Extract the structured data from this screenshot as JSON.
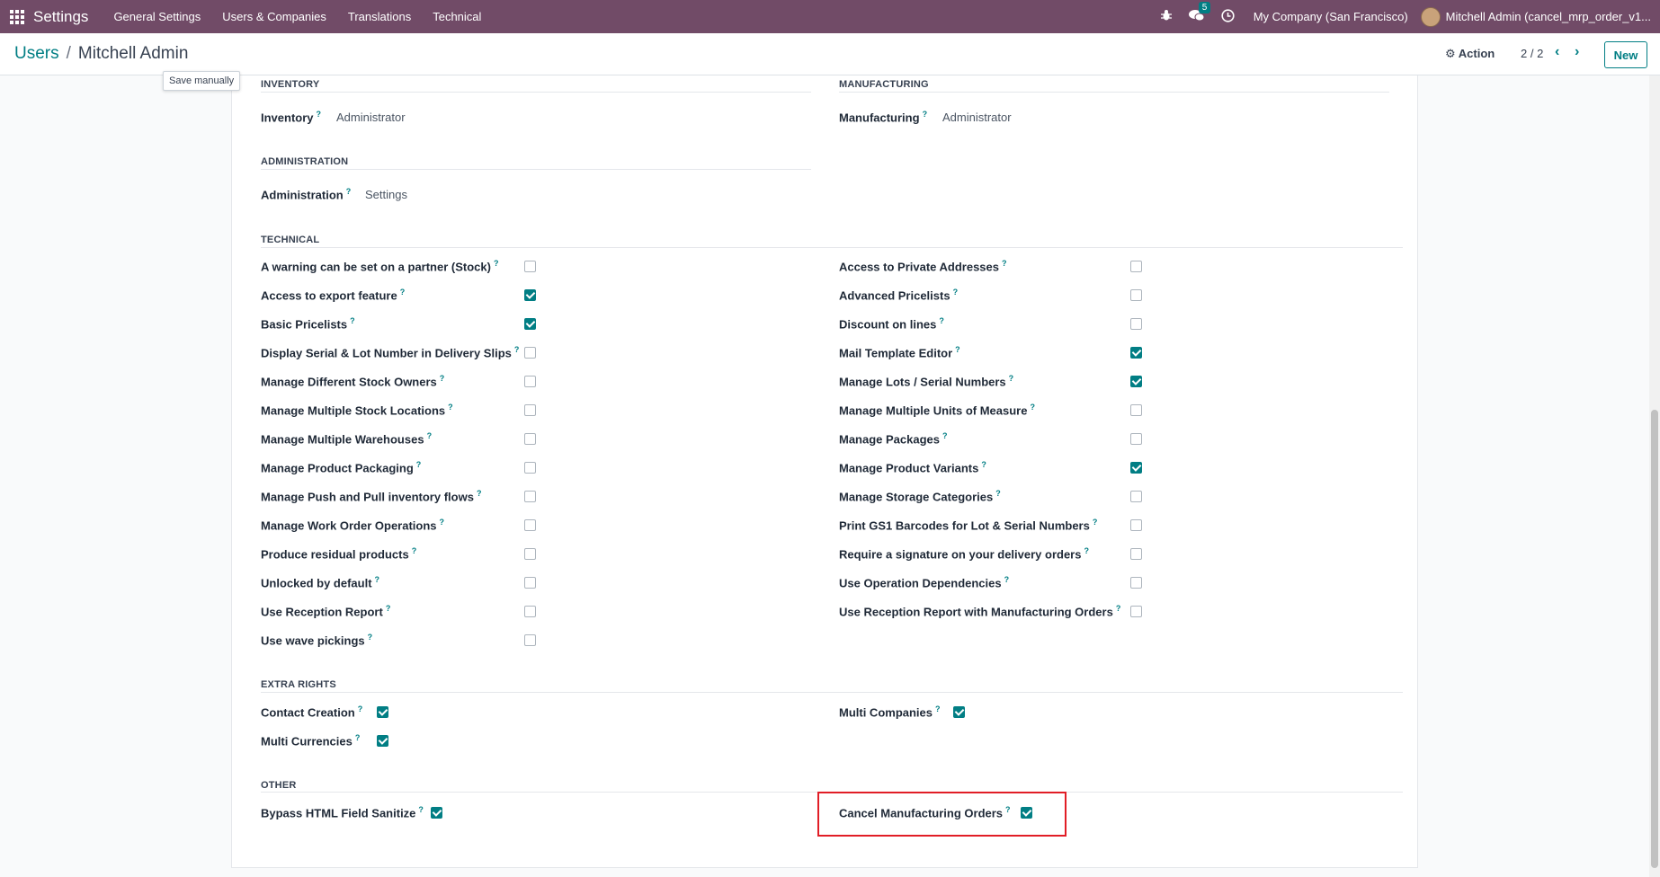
{
  "navbar": {
    "app_name": "Settings",
    "menu": [
      "General Settings",
      "Users & Companies",
      "Translations",
      "Technical"
    ],
    "chat_badge": "5",
    "company": "My Company (San Francisco)",
    "user": "Mitchell Admin (cancel_mrp_order_v1..."
  },
  "control": {
    "breadcrumb_parent": "Users",
    "breadcrumb_sep": "/",
    "breadcrumb_current": "Mitchell Admin",
    "tooltip": "Save manually",
    "action": "Action",
    "pager": "2 / 2",
    "new_label": "New"
  },
  "sections": {
    "inventory": {
      "title": "INVENTORY",
      "label": "Inventory",
      "value": "Administrator"
    },
    "manufacturing": {
      "title": "MANUFACTURING",
      "label": "Manufacturing",
      "value": "Administrator"
    },
    "administration": {
      "title": "ADMINISTRATION",
      "label": "Administration",
      "value": "Settings"
    },
    "technical": {
      "title": "TECHNICAL",
      "left": [
        {
          "label": "A warning can be set on a partner (Stock)",
          "checked": false
        },
        {
          "label": "Access to export feature",
          "checked": true
        },
        {
          "label": "Basic Pricelists",
          "checked": true
        },
        {
          "label": "Display Serial & Lot Number in Delivery Slips",
          "checked": false
        },
        {
          "label": "Manage Different Stock Owners",
          "checked": false
        },
        {
          "label": "Manage Multiple Stock Locations",
          "checked": false
        },
        {
          "label": "Manage Multiple Warehouses",
          "checked": false
        },
        {
          "label": "Manage Product Packaging",
          "checked": false
        },
        {
          "label": "Manage Push and Pull inventory flows",
          "checked": false
        },
        {
          "label": "Manage Work Order Operations",
          "checked": false
        },
        {
          "label": "Produce residual products",
          "checked": false
        },
        {
          "label": "Unlocked by default",
          "checked": false
        },
        {
          "label": "Use Reception Report",
          "checked": false
        },
        {
          "label": "Use wave pickings",
          "checked": false
        }
      ],
      "right": [
        {
          "label": "Access to Private Addresses",
          "checked": false
        },
        {
          "label": "Advanced Pricelists",
          "checked": false
        },
        {
          "label": "Discount on lines",
          "checked": false
        },
        {
          "label": "Mail Template Editor",
          "checked": true
        },
        {
          "label": "Manage Lots / Serial Numbers",
          "checked": true
        },
        {
          "label": "Manage Multiple Units of Measure",
          "checked": false
        },
        {
          "label": "Manage Packages",
          "checked": false
        },
        {
          "label": "Manage Product Variants",
          "checked": true
        },
        {
          "label": "Manage Storage Categories",
          "checked": false
        },
        {
          "label": "Print GS1 Barcodes for Lot & Serial Numbers",
          "checked": false
        },
        {
          "label": "Require a signature on your delivery orders",
          "checked": false
        },
        {
          "label": "Use Operation Dependencies",
          "checked": false
        },
        {
          "label": "Use Reception Report with Manufacturing Orders",
          "checked": false
        }
      ]
    },
    "extra_rights": {
      "title": "EXTRA RIGHTS",
      "left": [
        {
          "label": "Contact Creation",
          "checked": true
        },
        {
          "label": "Multi Currencies",
          "checked": true
        }
      ],
      "right": [
        {
          "label": "Multi Companies",
          "checked": true
        }
      ]
    },
    "other": {
      "title": "OTHER",
      "left": [
        {
          "label": "Bypass HTML Field Sanitize",
          "checked": true
        }
      ],
      "right": [
        {
          "label": "Cancel Manufacturing Orders",
          "checked": true
        }
      ]
    }
  },
  "help_marker": "?",
  "colors": {
    "navbar": "#714b67",
    "accent": "#017e84",
    "highlight": "#e11d26"
  }
}
